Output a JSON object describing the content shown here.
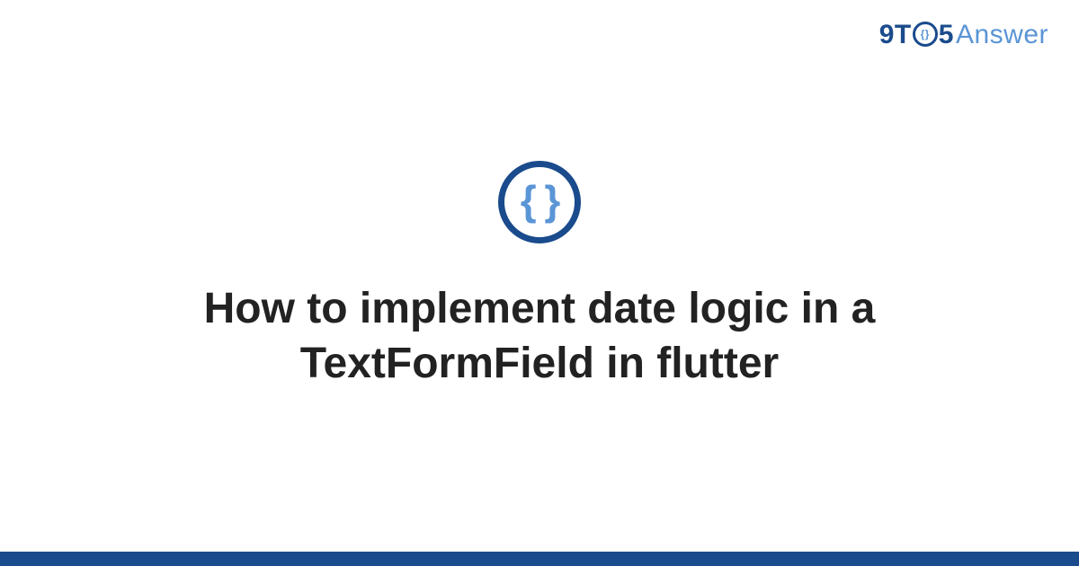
{
  "brand": {
    "prefix": "9T",
    "circle_inner": "{}",
    "mid": "5",
    "suffix": "Answer"
  },
  "logo": {
    "braces": "{ }"
  },
  "title": "How to implement date logic in a TextFormField in flutter",
  "colors": {
    "primary": "#1a4b8c",
    "accent": "#5a95d6",
    "text": "#222222"
  }
}
